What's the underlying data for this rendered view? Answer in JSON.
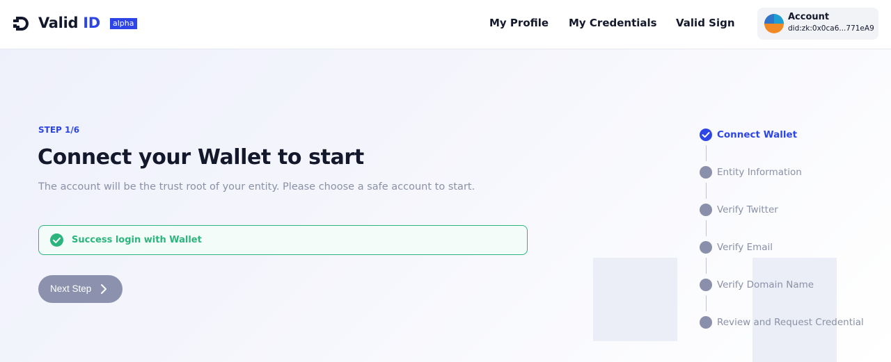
{
  "header": {
    "brand_main": "Valid",
    "brand_accent": "ID",
    "badge": "alpha",
    "nav": [
      "My Profile",
      "My Credentials",
      "Valid Sign"
    ],
    "account": {
      "title": "Account",
      "did": "did:zk:0x0ca6...771eA9"
    }
  },
  "main": {
    "step_label": "STEP 1/6",
    "title": "Connect your Wallet to start",
    "subtitle": "The account will be the trust root of your entity. Please choose a safe account to start.",
    "alert": "Success login with Wallet",
    "next_button": "Next Step"
  },
  "stepper": {
    "steps": [
      {
        "label": "Connect Wallet",
        "state": "done"
      },
      {
        "label": "Entity Information",
        "state": "pending"
      },
      {
        "label": "Verify Twitter",
        "state": "pending"
      },
      {
        "label": "Verify Email",
        "state": "pending"
      },
      {
        "label": "Verify Domain Name",
        "state": "pending"
      },
      {
        "label": "Review and Request Credential",
        "state": "pending"
      }
    ]
  },
  "colors": {
    "accent": "#2d45e6",
    "success": "#2bb57d",
    "muted": "#8a90a6",
    "button": "#8c92ad"
  },
  "icons": {
    "logo": "valid-id-logo-icon",
    "alert": "check-circle-icon",
    "next": "chevron-right-icon",
    "step_done": "check-icon"
  }
}
